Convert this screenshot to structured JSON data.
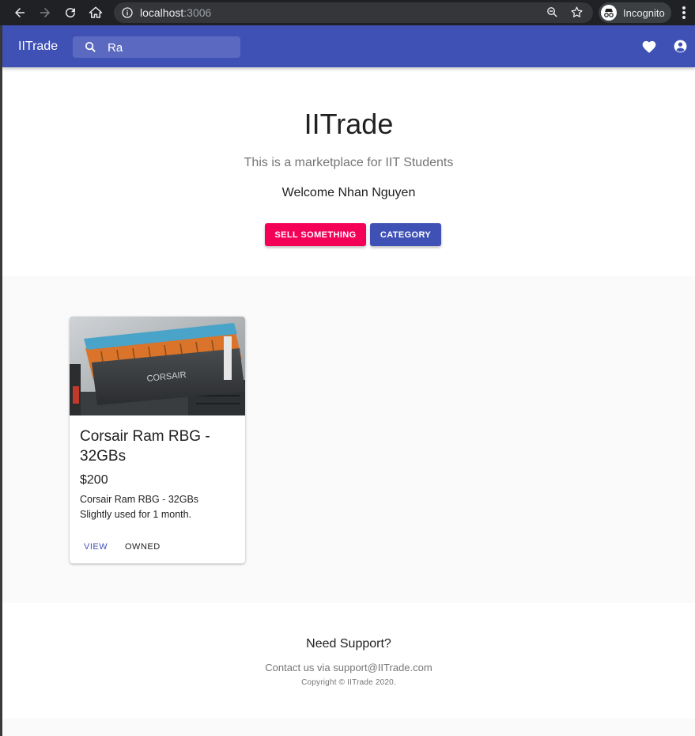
{
  "browser": {
    "url_host": "localhost",
    "url_port": ":3006",
    "profile_label": "Incognito"
  },
  "appbar": {
    "brand": "IITrade",
    "search_value": "Ra",
    "icons": [
      "search-icon",
      "favorite-heart-icon",
      "account-circle-icon"
    ]
  },
  "hero": {
    "title": "IITrade",
    "subtitle": "This is a marketplace for IIT Students",
    "welcome": "Welcome Nhan Nguyen",
    "sell_button": "SELL SOMETHING",
    "category_button": "CATEGORY"
  },
  "products": [
    {
      "title": "Corsair Ram RBG - 32GBs",
      "price": "$200",
      "description_line1": "Corsair Ram RBG - 32GBs",
      "description_line2": "Slightly used for 1 month.",
      "view_label": "VIEW",
      "owned_label": "OWNED"
    }
  ],
  "footer": {
    "title": "Need Support?",
    "contact": "Contact us via support@IITrade.com",
    "copyright": "Copyright © IITrade 2020."
  },
  "colors": {
    "primary": "#3f51b5",
    "secondary": "#f50057"
  }
}
